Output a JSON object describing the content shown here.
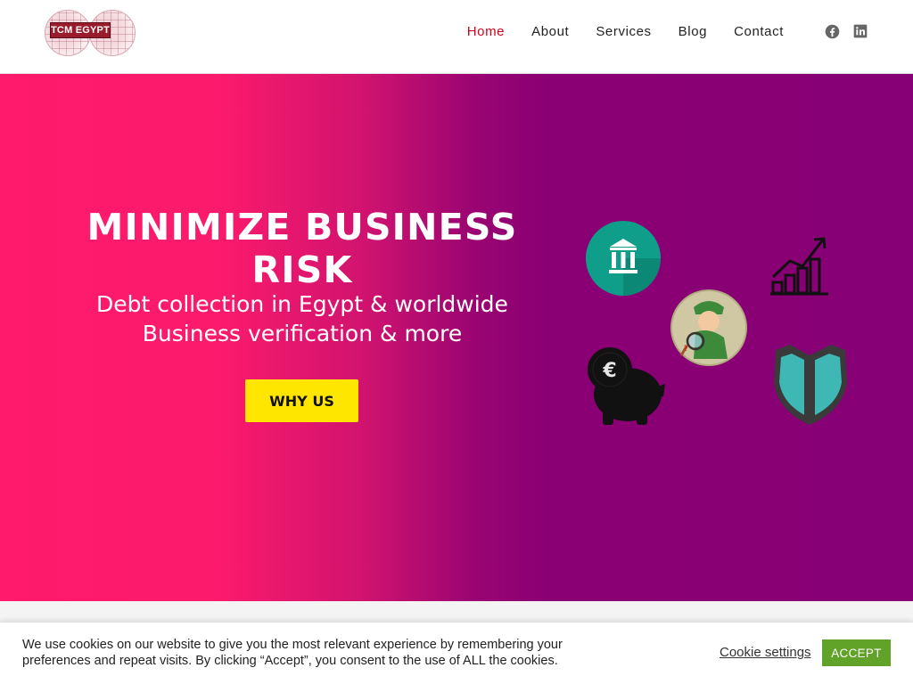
{
  "header": {
    "logo_text": "TCM EGYPT",
    "nav": [
      {
        "label": "Home",
        "active": true
      },
      {
        "label": "About",
        "active": false
      },
      {
        "label": "Services",
        "active": false
      },
      {
        "label": "Blog",
        "active": false
      },
      {
        "label": "Contact",
        "active": false
      }
    ],
    "social_icons": [
      "facebook-icon",
      "linkedin-icon"
    ]
  },
  "hero": {
    "title": "MINIMIZE BUSINESS RISK",
    "subtitle_line1": "Debt collection in Egypt & worldwide",
    "subtitle_line2": "Business verification & more",
    "cta_label": "WHY US",
    "icons": [
      "bank-icon",
      "growth-chart-icon",
      "detective-icon",
      "euro-piggy-bank-icon",
      "shield-icon"
    ]
  },
  "cookie_bar": {
    "text": "We use cookies on our website to give you the most relevant experience by remembering your preferences and repeat visits. By clicking “Accept”, you consent to the use of ALL the cookies.",
    "settings_label": "Cookie settings",
    "accept_label": "ACCEPT"
  },
  "colors": {
    "accent": "#d0021b",
    "hero_gradient_start": "#ff1a6b",
    "hero_gradient_end": "#880075",
    "cta_bg": "#ffe600",
    "accept_bg": "#61a229"
  }
}
